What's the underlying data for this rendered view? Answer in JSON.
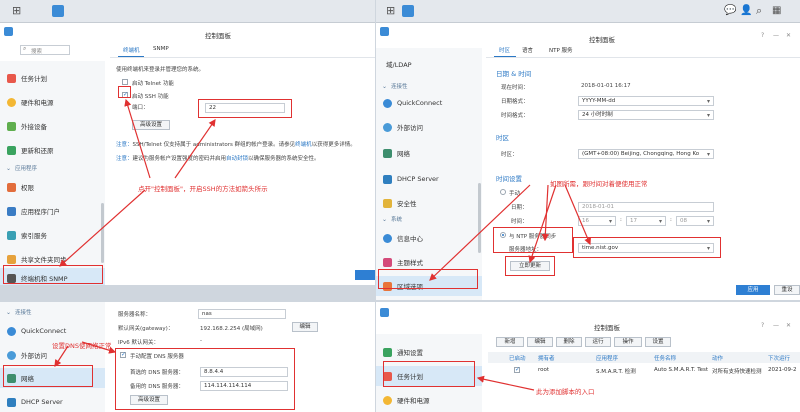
{
  "colors": {
    "accent": "#2b78c5",
    "annotation": "#e03131",
    "primary_button": "#2e7fd3"
  },
  "win1": {
    "title": "控制面板",
    "search_placeholder": "搜索",
    "tabs": [
      "终端机",
      "SNMP"
    ],
    "sidebar": {
      "items": [
        {
          "label": "任务计划",
          "icon": "calendar-icon"
        },
        {
          "label": "硬件和电源",
          "icon": "bulb-icon"
        },
        {
          "label": "外接设备",
          "icon": "device-icon"
        },
        {
          "label": "更新和还原",
          "icon": "update-icon"
        }
      ],
      "section_app": "应用程序",
      "app_items": [
        {
          "label": "权限",
          "icon": "permission-icon"
        },
        {
          "label": "应用程序门户",
          "icon": "portal-icon"
        },
        {
          "label": "索引服务",
          "icon": "index-icon"
        },
        {
          "label": "共享文件夹同步",
          "icon": "sync-icon"
        },
        {
          "label": "终端机和 SNMP",
          "icon": "terminal-icon"
        }
      ]
    },
    "desc": "使用终端机来登录并管理您的系统。",
    "telnet_label": "启动 Telnet 功能",
    "ssh_label": "启动 SSH 功能",
    "port_label": "端口：",
    "port_value": "22",
    "advanced_button": "高级设置",
    "note1_prefix": "注意：",
    "note1": "SSH/Telnet 仅支持属于 administrators 群组的帐户登录。请参见",
    "note1_link": "终端机",
    "note1_suffix": "以获得更多详情。",
    "note2_prefix": "注意：",
    "note2": "建议为服务帐户设置强度的密码并启用",
    "note2_link": "自动封锁",
    "note2_suffix": "以确保服务器的系统安全性。",
    "annotation": "点开\"控制面板\"，开启SSH的方法如箭头所示"
  },
  "win2": {
    "title": "控制面板",
    "tabs": [
      "时区",
      "语言",
      "NTP 服务"
    ],
    "sidebar": {
      "top_item": "域/LDAP",
      "section_connect": "连接性",
      "items": [
        {
          "label": "QuickConnect",
          "icon": "quickconnect-icon"
        },
        {
          "label": "外部访问",
          "icon": "globe-icon"
        },
        {
          "label": "网络",
          "icon": "network-icon"
        },
        {
          "label": "DHCP Server",
          "icon": "dhcp-icon"
        },
        {
          "label": "安全性",
          "icon": "shield-icon"
        }
      ],
      "section_system": "系统",
      "sys_items": [
        {
          "label": "信息中心",
          "icon": "info-icon"
        },
        {
          "label": "主题样式",
          "icon": "theme-icon"
        },
        {
          "label": "区域选项",
          "icon": "region-icon"
        }
      ]
    },
    "datetime_header": "日期 & 时间",
    "current_time_label": "现在时间：",
    "current_time_value": "2018-01-01 16:17",
    "date_format_label": "日期格式：",
    "date_format_value": "YYYY-MM-dd",
    "time_format_label": "时间格式：",
    "time_format_value": "24 小时时制",
    "timezone_header": "时区",
    "timezone_label": "时区：",
    "timezone_value": "(GMT+08:00) Beijing, Chongqing, Hong Ko",
    "time_settings_header": "时间设置",
    "manual_label": "手动",
    "date_label": "日期：",
    "date_value": "2018-01-01",
    "time_label": "时间：",
    "time_h": "16",
    "time_m": "17",
    "time_s": "08",
    "ntp_label": "与 NTP 服务器同步",
    "server_label": "服务器地址：",
    "server_value": "time.nist.gov",
    "update_button": "立即更新",
    "apply_button": "应用",
    "reset_button": "重设",
    "annotation": "如图所需，跟时间对着便使用正常"
  },
  "win3": {
    "sidebar": {
      "section_connect": "连接性",
      "items": [
        {
          "label": "QuickConnect",
          "icon": "quickconnect-icon"
        },
        {
          "label": "外部访问",
          "icon": "globe-icon"
        },
        {
          "label": "网络",
          "icon": "network-icon"
        },
        {
          "label": "DHCP Server",
          "icon": "dhcp-icon"
        }
      ]
    },
    "server_name_label": "服务器名称：",
    "server_name_value": "nas",
    "gateway_label": "默认网关(gateway)：",
    "gateway_value": "192.168.2.254 (局域网)",
    "edit_button": "编辑",
    "ipv6_label": "IPv6 默认网关：",
    "ipv6_value": "-",
    "manual_dns_label": "手动配置 DNS 服务器",
    "dns1_label": "首选的 DNS 服务器：",
    "dns1_value": "8.8.4.4",
    "dns2_label": "备用的 DNS 服务器：",
    "dns2_value": "114.114.114.114",
    "advanced_button": "高级设置",
    "annotation": "设置DNS使网络正常"
  },
  "win4": {
    "title": "控制面板",
    "toolbar": [
      "新增",
      "编辑",
      "删除",
      "运行",
      "操作",
      "设置"
    ],
    "sidebar": {
      "items": [
        {
          "label": "通知设置",
          "icon": "notify-icon"
        },
        {
          "label": "任务计划",
          "icon": "calendar-icon"
        },
        {
          "label": "硬件和电源",
          "icon": "bulb-icon"
        }
      ]
    },
    "columns": [
      "已启动",
      "拥有者",
      "应用程序",
      "任务名称",
      "动作",
      "下次运行"
    ],
    "row": {
      "owner": "root",
      "app": "S.M.A.R.T. 检测",
      "task": "Auto S.M.A.R.T. Test",
      "action": "对所有支持快速检测",
      "next": "2021-09-2"
    },
    "annotation": "此为添加脚本的入口"
  }
}
